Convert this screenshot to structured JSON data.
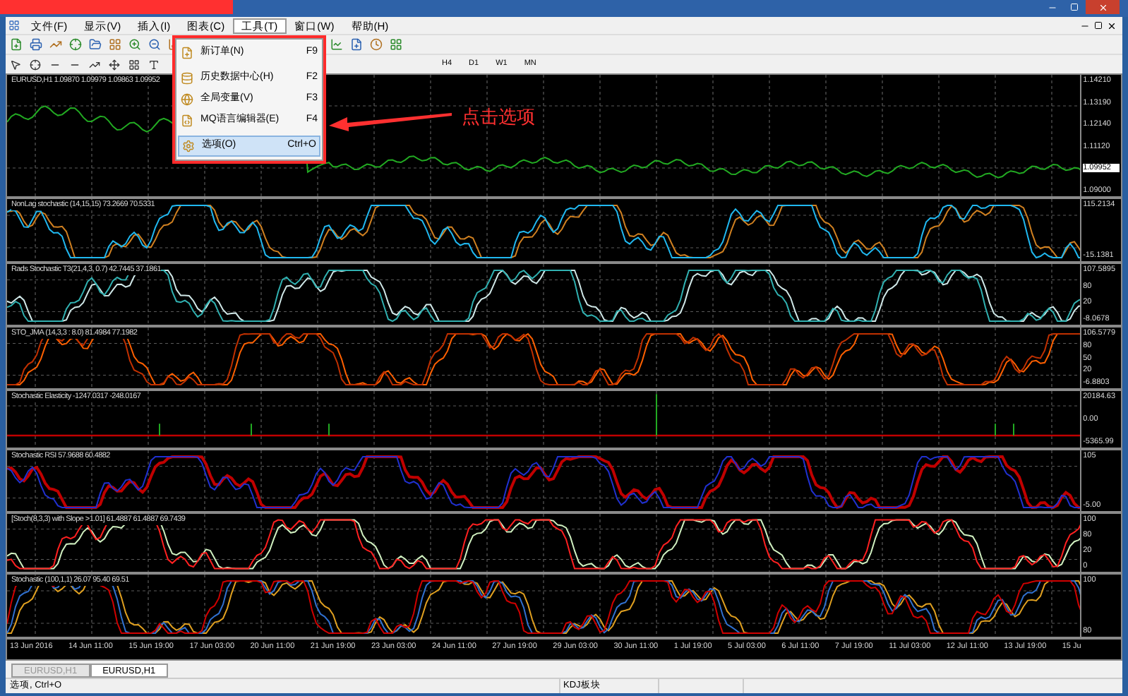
{
  "menu": [
    {
      "label": "文件(F)",
      "selected": false
    },
    {
      "label": "显示(V)",
      "selected": false
    },
    {
      "label": "插入(I)",
      "selected": false
    },
    {
      "label": "图表(C)",
      "selected": false
    },
    {
      "label": "工具(T)",
      "selected": true
    },
    {
      "label": "窗口(W)",
      "selected": false
    },
    {
      "label": "帮助(H)",
      "selected": false
    }
  ],
  "dropdown": [
    {
      "label": "新订单(N)",
      "shortcut": "F9",
      "selected": false
    },
    {
      "label": "历史数据中心(H)",
      "shortcut": "F2",
      "selected": false
    },
    {
      "label": "全局变量(V)",
      "shortcut": "F3",
      "selected": false
    },
    {
      "label": "MQ语言编辑器(E)",
      "shortcut": "F4",
      "selected": false
    },
    {
      "label": "选项(O)",
      "shortcut": "Ctrl+O",
      "selected": true
    }
  ],
  "annotation": "点击选项",
  "timeframes": [
    "H4",
    "D1",
    "W1",
    "MN"
  ],
  "panes": [
    {
      "kind": "price",
      "label": "EURUSD,H1 1.09870 1.09979 1.09863 1.09952",
      "axis": [
        "1.14210",
        "1.13190",
        "1.12140",
        "1.11120",
        "1.09000"
      ],
      "price_marker": "1.09952"
    },
    {
      "kind": "oscillator",
      "label": "NonLag stochastic (14,15,15) 73.2669 70.5331",
      "axis": [
        "115.2134",
        "-15.1381"
      ]
    },
    {
      "kind": "oscillator",
      "label": "Rads Stochastic T3(21,4,3, 0.7) 42.7445 37.1861",
      "axis": [
        "107.5895",
        "80",
        "20",
        "-8.0678"
      ]
    },
    {
      "kind": "oscillator",
      "label": "STO_JMA (14,3,3 : 8.0) 81.4984 77.1982",
      "axis": [
        "106.5779",
        "80",
        "50",
        "20",
        "-6.8803"
      ]
    },
    {
      "kind": "histogram",
      "label": "Stochastic Elasticity -1247.0317 -248.0167",
      "axis": [
        "20184.63",
        "0.00",
        "-5365.99"
      ]
    },
    {
      "kind": "oscillator",
      "label": "Stochastic RSI 57.9688 60.4882",
      "axis": [
        "105",
        "-5.00"
      ]
    },
    {
      "kind": "oscillator",
      "label": "[Stoch(8,3,3) with Slope >1.01] 61.4887 61.4887 69.7439",
      "axis": [
        "100",
        "80",
        "20",
        "0"
      ]
    },
    {
      "kind": "oscillator",
      "label": "Stochastic (100,1,1) 26.07 95.40 69.51",
      "axis": [
        "100",
        "80"
      ]
    }
  ],
  "dates": [
    "13 Jun 2016",
    "14 Jun 11:00",
    "15 Jun 19:00",
    "17 Jun 03:00",
    "20 Jun 11:00",
    "21 Jun 19:00",
    "23 Jun 03:00",
    "24 Jun 11:00",
    "27 Jun 19:00",
    "29 Jun 03:00",
    "30 Jun 11:00",
    "1 Jul 19:00",
    "5 Jul 03:00",
    "6 Jul 11:00",
    "7 Jul 19:00",
    "11 Jul 03:00",
    "12 Jul 11:00",
    "13 Jul 19:00",
    "15 Ju"
  ],
  "tabs": [
    {
      "label": "EURUSD,H1",
      "selected": false
    },
    {
      "label": "EURUSD,H1",
      "selected": true
    }
  ],
  "status_bar": [
    "选项, Ctrl+O",
    "KDJ板块"
  ]
}
